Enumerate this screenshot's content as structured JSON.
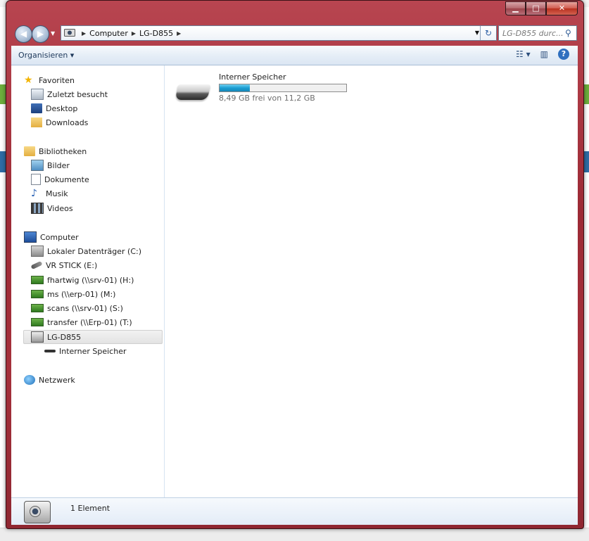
{
  "window": {
    "buttons": {
      "minimize": "▁",
      "maximize": "□",
      "close": "✕"
    }
  },
  "address_bar": {
    "crumbs": [
      "Computer",
      "LG-D855"
    ],
    "search_placeholder": "LG-D855 durc..."
  },
  "toolbar": {
    "organize_label": "Organisieren ▾",
    "help_label": "?"
  },
  "nav": {
    "favorites": {
      "label": "Favoriten",
      "items": [
        "Zuletzt besucht",
        "Desktop",
        "Downloads"
      ]
    },
    "libraries": {
      "label": "Bibliotheken",
      "items": [
        "Bilder",
        "Dokumente",
        "Musik",
        "Videos"
      ]
    },
    "computer": {
      "label": "Computer",
      "items": [
        "Lokaler Datenträger (C:)",
        "VR STICK (E:)",
        "fhartwig (\\\\srv-01) (H:)",
        "ms (\\\\erp-01) (M:)",
        "scans (\\\\srv-01) (S:)",
        "transfer (\\\\Erp-01) (T:)",
        "LG-D855"
      ],
      "sub_item": "Interner Speicher"
    },
    "network": {
      "label": "Netzwerk"
    }
  },
  "content": {
    "drive": {
      "name": "Interner Speicher",
      "used_fraction": 0.24,
      "free_text": "8,49 GB frei von 11,2 GB"
    }
  },
  "details": {
    "count_text": "1 Element"
  },
  "colors": {
    "frame": "#a5303b",
    "toolbar": "#e6eef7",
    "bar_fill": "#1c9fd3",
    "selection": "#e3e3e3"
  }
}
